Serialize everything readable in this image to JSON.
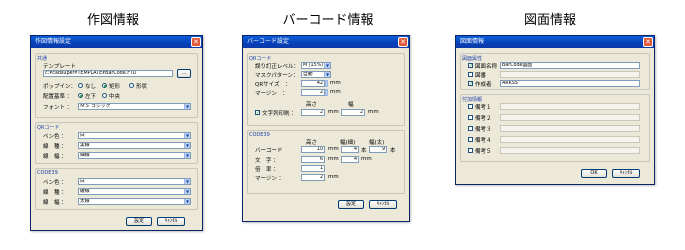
{
  "headings": [
    "作図情報",
    "バーコード情報",
    "図面情報"
  ],
  "dialog1": {
    "title": "作図情報設定",
    "common_group": "共通",
    "template_label": "テンプレート",
    "template_value": "c:¥cadsuper¥TEMPLATE¥BarCode.FTD",
    "browse_label": "...",
    "popup_label": "ポップイン：",
    "popup_options": [
      "なし",
      "矩形",
      "形状"
    ],
    "align_label": "配置基準 ：",
    "align_options": [
      "左下",
      "中央"
    ],
    "font_label": "フォント ：",
    "font_value": "ＭＳ ゴシック",
    "qr_group": "QRコード",
    "qr_rows": [
      {
        "label": "ペン色 ：",
        "value": "白"
      },
      {
        "label": "線　種 ：",
        "value": "実線"
      },
      {
        "label": "線　幅 ：",
        "value": "細線"
      }
    ],
    "code_group": "CODE39",
    "code_rows": [
      {
        "label": "ペン色 ：",
        "value": "白"
      },
      {
        "label": "線　種 ：",
        "value": "破線"
      },
      {
        "label": "線　幅 ：",
        "value": "太線"
      }
    ],
    "ok_label": "設定",
    "cancel_label": "ｷｬﾝｾﾙ"
  },
  "dialog2": {
    "title": "バーコード設定",
    "qr_group": "QRコード",
    "qr_rows": [
      {
        "label": "誤り訂正レベル：",
        "value": "M (15%)"
      },
      {
        "label": "マスクパターン：",
        "value": "自動"
      },
      {
        "label": "QRサイズ　：",
        "value": "42",
        "unit": "mm"
      },
      {
        "label": "マージン　：",
        "value": "2",
        "unit": "mm"
      }
    ],
    "height_label": "高さ",
    "width_label": "幅",
    "char_cb_label": "文字列印刷 ：",
    "char_h": "2",
    "char_w": "2",
    "mm": "mm",
    "code_group": "CODE39",
    "col_height": "高さ",
    "col_thin": "幅(細)",
    "col_thick": "幅(太)",
    "barcode_label": "バーコード",
    "bar_h": "10",
    "bar_thin": "4",
    "bar_thick": "9",
    "hon": "本",
    "char_label": "文　字 ：",
    "char2_h": "6",
    "char2_w": "4",
    "ratio_label": "倍　率 ：",
    "ratio_val": "1",
    "margin_label": "マージン ：",
    "margin_val": "2",
    "ok_label": "設定",
    "cancel_label": "ｷｬﾝｾﾙ"
  },
  "dialog3": {
    "title": "図面情報",
    "prop_group": "図面属性",
    "props": [
      {
        "label": "図面名称",
        "value": "BarCode図面",
        "checked": true
      },
      {
        "label": "図番",
        "value": "",
        "checked": false
      },
      {
        "label": "作成者",
        "value": "ARKSS",
        "checked": true
      }
    ],
    "add_group": "付加情報",
    "notes": [
      "備考１",
      "備考２",
      "備考３",
      "備考４",
      "備考５"
    ],
    "ok_label": "OK",
    "cancel_label": "ｷｬﾝｾﾙ"
  }
}
